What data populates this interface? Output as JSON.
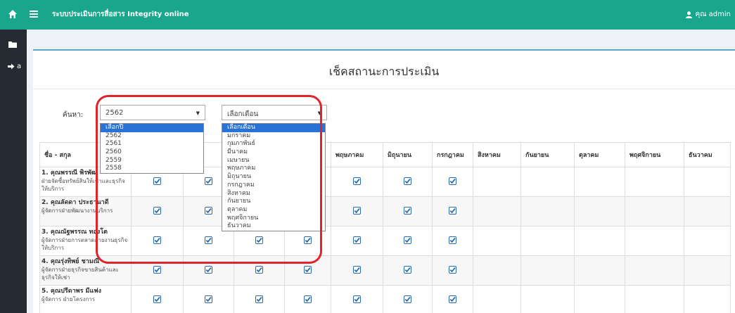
{
  "topbar": {
    "title": "ระบบประเมินการสื่อสาร Integrity online",
    "user": "คุณ admin",
    "colors": {
      "bar": "#19a68c",
      "sidebar": "#262b33",
      "accent": "#e0242a"
    }
  },
  "sidebar": {
    "signout_label": "a"
  },
  "page": {
    "title": "เช็คสถานะการประเมิน"
  },
  "search": {
    "label": "ค้นหา:",
    "year_value": "2562",
    "month_value": "เลือกเดือน",
    "year_options": [
      "เลือกปี",
      "2562",
      "2561",
      "2560",
      "2559",
      "2558"
    ],
    "month_options": [
      "เลือกเดือน",
      "มกราคม",
      "กุมภาพันธ์",
      "มีนาคม",
      "เมษายน",
      "พฤษภาคม",
      "มิถุนายน",
      "กรกฎาคม",
      "สิงหาคม",
      "กันยายน",
      "ตุลาคม",
      "พฤศจิกายน",
      "ธันวาคม"
    ]
  },
  "table": {
    "headers": [
      "ชื่อ - สกุล",
      "",
      "พันธ์",
      "",
      "",
      "พฤษภาคม",
      "มิถุนายน",
      "กรกฎาคม",
      "สิงหาคม",
      "กันยายน",
      "ตุลาคม",
      "พฤศจิกายน",
      "ธันวาคม"
    ],
    "rows": [
      {
        "name": "1. คุณพรรณี พิรพัฒ",
        "role": "ฝ่ายจัดซื้อทรัพย์สินให้เช่าและธุรกิจให้บริการ",
        "checks": [
          1,
          1,
          1,
          1,
          1,
          1,
          1,
          0,
          0,
          0,
          0,
          0
        ]
      },
      {
        "name": "2. คุณลัดดา ประธานาดี",
        "role": "ผู้จัดการฝ่ายพัฒนางานบริการ",
        "checks": [
          1,
          1,
          1,
          1,
          1,
          1,
          1,
          0,
          0,
          0,
          0,
          0
        ]
      },
      {
        "name": "3. คุณณัฐพรรณ ทองโต",
        "role": "ผู้จัดการฝ่ายการตลาดสายงานธุรกิจให้บริการ",
        "checks": [
          1,
          1,
          1,
          1,
          1,
          1,
          1,
          0,
          0,
          0,
          0,
          0
        ]
      },
      {
        "name": "4. คุณรุ่งทิพย์ ชามณี",
        "role": "ผู้จัดการฝ่ายธุรกิจขายสินค้าและธุรกิจให้เช่า",
        "checks": [
          1,
          1,
          1,
          1,
          1,
          1,
          1,
          0,
          0,
          0,
          0,
          0
        ]
      },
      {
        "name": "5. คุณปรีดาพร มีแฟง",
        "role": "ผู้จัดการ ฝ่ายโครงการ",
        "checks": [
          1,
          1,
          1,
          1,
          1,
          1,
          1,
          0,
          0,
          0,
          0,
          0
        ]
      }
    ]
  }
}
